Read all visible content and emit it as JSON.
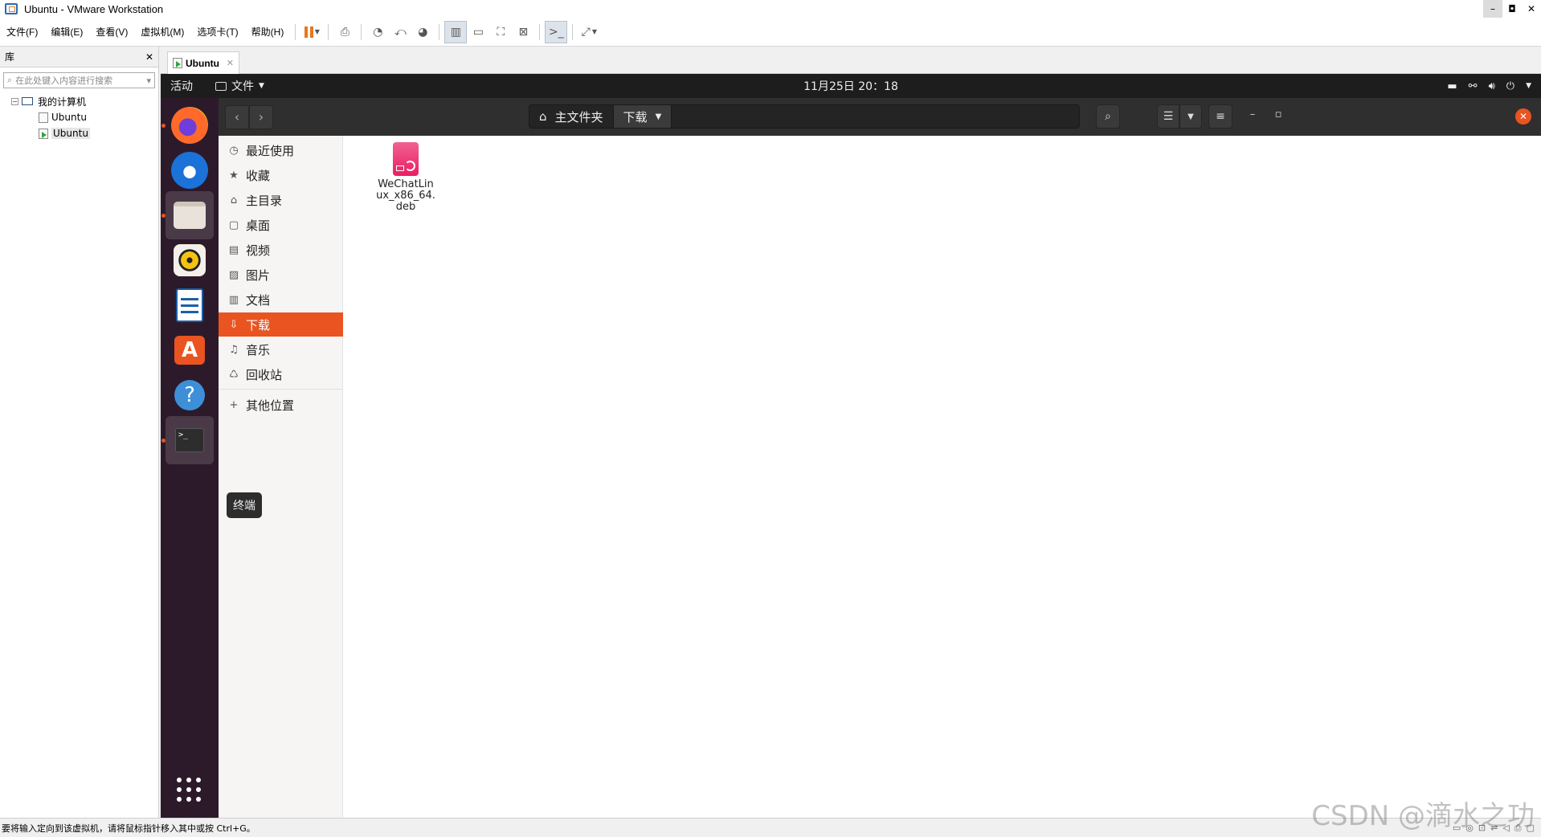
{
  "window": {
    "title": "Ubuntu - VMware Workstation",
    "controls": [
      "–",
      "◘",
      "✕"
    ]
  },
  "menubar": {
    "items": [
      "文件(F)",
      "编辑(E)",
      "查看(V)",
      "虚拟机(M)",
      "选项卡(T)",
      "帮助(H)"
    ]
  },
  "library": {
    "title": "库",
    "close": "✕",
    "search_placeholder": "在此处键入内容进行搜索",
    "tree": {
      "root": "我的计算机",
      "expander": "−",
      "children": [
        "Ubuntu",
        "Ubuntu"
      ]
    }
  },
  "tab": {
    "label": "Ubuntu",
    "close": "✕"
  },
  "ubuntu": {
    "topbar": {
      "activities": "活动",
      "app_menu": "文件",
      "clock": "11月25日 20：18"
    },
    "tooltip": "终端",
    "nautilus": {
      "path": [
        "主文件夹",
        "下载"
      ],
      "sidebar": [
        {
          "icon": "clock-icon",
          "glyph": "◷",
          "label": "最近使用"
        },
        {
          "icon": "star-icon",
          "glyph": "★",
          "label": "收藏"
        },
        {
          "icon": "home-icon",
          "glyph": "⌂",
          "label": "主目录"
        },
        {
          "icon": "desktop-icon",
          "glyph": "▢",
          "label": "桌面"
        },
        {
          "icon": "video-icon",
          "glyph": "▤",
          "label": "视频"
        },
        {
          "icon": "picture-icon",
          "glyph": "▨",
          "label": "图片"
        },
        {
          "icon": "document-icon",
          "glyph": "▥",
          "label": "文档"
        },
        {
          "icon": "download-icon",
          "glyph": "⇩",
          "label": "下载"
        },
        {
          "icon": "music-icon",
          "glyph": "♫",
          "label": "音乐"
        },
        {
          "icon": "trash-icon",
          "glyph": "♺",
          "label": "回收站"
        },
        {
          "icon": "plus-icon",
          "glyph": "+",
          "label": "其他位置"
        }
      ],
      "active_sidebar": "下载",
      "files": [
        {
          "name": "WeChatLinux_x86_64.deb",
          "line1": "WeChatLin",
          "line2": "ux_x86_64.",
          "line3": "deb",
          "icon": "deb-package-icon"
        }
      ]
    }
  },
  "statusbar": {
    "text": "要将输入定向到该虚拟机，请将鼠标指针移入其中或按 Ctrl+G。"
  },
  "watermark": "CSDN @滴水之功",
  "colors": {
    "ubuntu_orange": "#e95420",
    "dock_bg": "#2c1a2b",
    "vmware_pause": "#e8771e"
  }
}
